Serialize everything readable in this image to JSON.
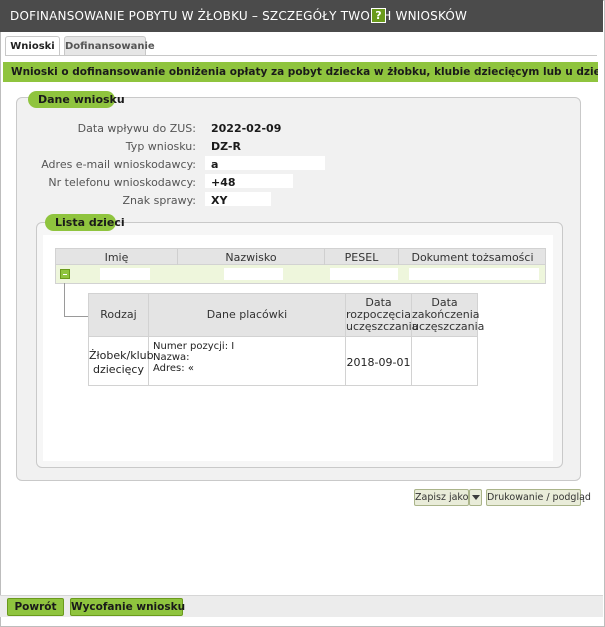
{
  "window": {
    "title": "DOFINANSOWANIE POBYTU W ŻŁOBKU – SZCZEGÓŁY TWOICH WNIOSKÓW",
    "help_label": "?"
  },
  "tabs": [
    {
      "label": "Wnioski",
      "active": true
    },
    {
      "label": "Dofinansowanie",
      "active": false
    }
  ],
  "banner": "Wnioski o dofinansowanie obniżenia opłaty za pobyt dziecka w żłobku, klubie dziecięcym lub u dziennego opiekuna",
  "dane_wniosku": {
    "section_title": "Dane wniosku",
    "fields": [
      {
        "label": "Data wpływu do ZUS:",
        "value": "2022-02-09"
      },
      {
        "label": "Typ wniosku:",
        "value": "DZ-R"
      },
      {
        "label": "Adres e-mail wnioskodawcy:",
        "value": "a"
      },
      {
        "label": "Nr telefonu wnioskodawcy:",
        "value": "+48"
      },
      {
        "label": "Znak sprawy:",
        "value": "XY"
      }
    ]
  },
  "lista_dzieci": {
    "section_title": "Lista dzieci",
    "columns": [
      "Imię",
      "Nazwisko",
      "PESEL",
      "Dokument tożsamości"
    ],
    "subtable": {
      "columns": [
        "Rodzaj",
        "Dane placówki",
        "Data rozpoczęcia uczęszczania",
        "Data zakończenia uczęszczania"
      ],
      "row": {
        "rodzaj": "Żłobek/klub dziecięcy",
        "placowka": [
          "Numer pozycji: I",
          "Nazwa:",
          "Adres: «"
        ],
        "data_rozpoczecia": "2018-09-01",
        "data_zakonczenia": ""
      }
    }
  },
  "actions": {
    "save_as": "Zapisz jako",
    "print_preview": "Drukowanie / podgląd"
  },
  "footer": {
    "back": "Powrót",
    "withdraw": "Wycofanie wniosku"
  },
  "colors": {
    "accent_green": "#8fc43e",
    "titlebar": "#4b4b4b"
  }
}
